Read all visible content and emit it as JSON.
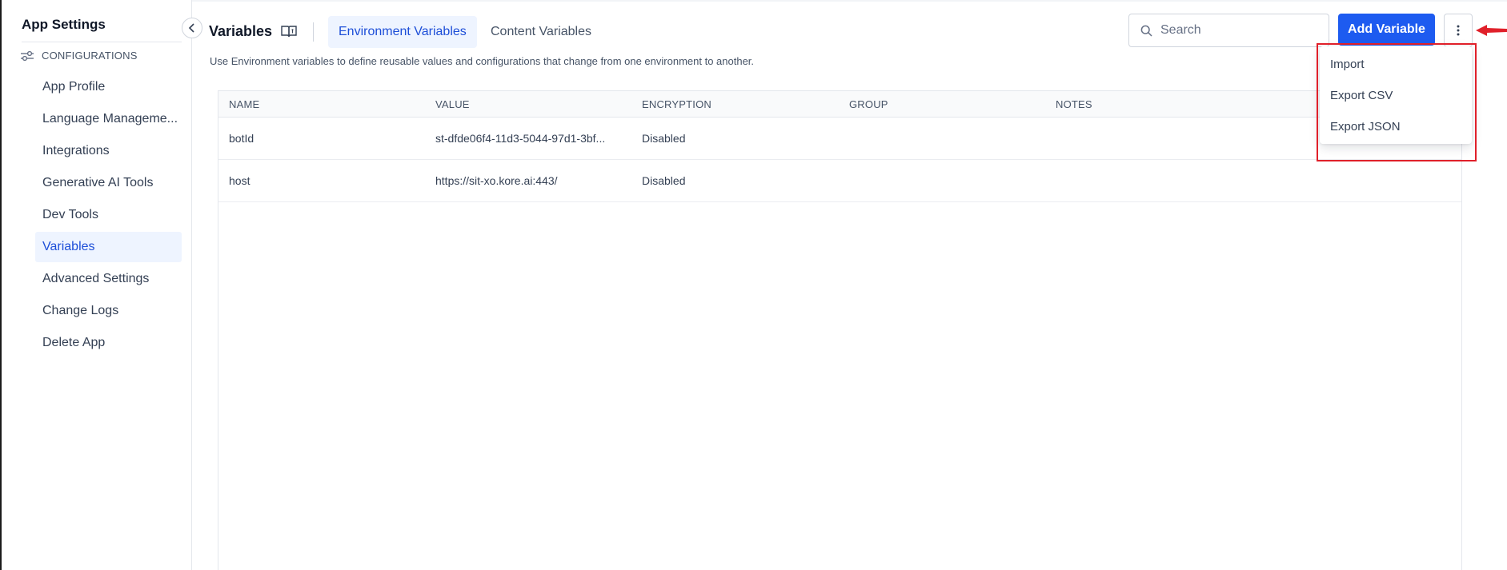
{
  "sidebar": {
    "title": "App Settings",
    "section_label": "CONFIGURATIONS",
    "items": [
      {
        "label": "App Profile",
        "active": false
      },
      {
        "label": "Language Manageme...",
        "active": false
      },
      {
        "label": "Integrations",
        "active": false
      },
      {
        "label": "Generative AI Tools",
        "active": false
      },
      {
        "label": "Dev Tools",
        "active": false
      },
      {
        "label": "Variables",
        "active": true
      },
      {
        "label": "Advanced Settings",
        "active": false
      },
      {
        "label": "Change Logs",
        "active": false
      },
      {
        "label": "Delete App",
        "active": false
      }
    ]
  },
  "header": {
    "title": "Variables",
    "tabs": [
      {
        "label": "Environment Variables",
        "active": true
      },
      {
        "label": "Content Variables",
        "active": false
      }
    ],
    "subtitle": "Use Environment variables to define reusable values and configurations that change from one environment to another.",
    "search_placeholder": "Search",
    "search_value": "",
    "add_button_label": "Add Variable"
  },
  "table": {
    "columns": [
      "NAME",
      "VALUE",
      "ENCRYPTION",
      "GROUP",
      "NOTES"
    ],
    "rows": [
      {
        "name": "botId",
        "value": "st-dfde06f4-11d3-5044-97d1-3bf...",
        "encryption": "Disabled",
        "group": "",
        "notes": ""
      },
      {
        "name": "host",
        "value": "https://sit-xo.kore.ai:443/",
        "encryption": "Disabled",
        "group": "",
        "notes": ""
      }
    ]
  },
  "menu": {
    "items": [
      "Import",
      "Export CSV",
      "Export JSON"
    ]
  },
  "colors": {
    "accent": "#1d5bf0",
    "active_bg": "#eef4ff",
    "active_text": "#1d4ed8",
    "highlight": "#e0202a"
  },
  "icons": {
    "collapse": "chevron-left-icon",
    "section": "sliders-icon",
    "docs": "book-icon",
    "search": "search-icon",
    "more": "vertical-dots-icon",
    "annotation": "red-arrow-icon"
  }
}
